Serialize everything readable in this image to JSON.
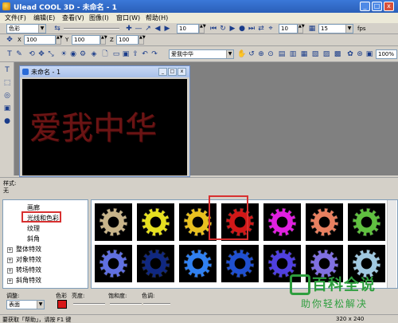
{
  "window": {
    "title": "Ulead COOL 3D - 未命名 - 1",
    "min": "_",
    "max": "□",
    "close": "x"
  },
  "menu": [
    "文件(F)",
    "编辑(E)",
    "查看(V)",
    "图像(I)",
    "窗口(W)",
    "帮助(H)"
  ],
  "toolbar1": {
    "color_mode": "色彩",
    "frame_value": "10",
    "frame_value2": "10",
    "fps_value": "15",
    "fps_label": "fps"
  },
  "toolbar2": {
    "x_label": "X",
    "x_value": "100",
    "y_label": "Y",
    "y_value": "100",
    "z_label": "Z",
    "z_value": "100"
  },
  "toolbar3": {
    "text_object": "爱我中华",
    "zoom": "100%"
  },
  "doc": {
    "title": "未命名 - 1",
    "canvas_text": "爱我中华"
  },
  "style_panel": {
    "label": "样式:",
    "value": "无"
  },
  "tree": {
    "items": [
      {
        "label": "画廊",
        "expander": ""
      },
      {
        "label": "光线和色彩",
        "expander": ""
      },
      {
        "label": "纹理",
        "expander": ""
      },
      {
        "label": "斜角",
        "expander": ""
      },
      {
        "label": "整体特效",
        "expander": "+"
      },
      {
        "label": "对象特效",
        "expander": "+"
      },
      {
        "label": "转场特效",
        "expander": "+"
      },
      {
        "label": "斜角特效",
        "expander": "+"
      }
    ]
  },
  "gallery": {
    "row1": [
      "#c8b48a",
      "#e6e020",
      "#e8c020",
      "#d01818",
      "#e020e0",
      "#e88060",
      "#60c040"
    ],
    "row2": [
      "#6070e0",
      "#102880",
      "#3080f0",
      "#2050d0",
      "#5040e0",
      "#8070e0",
      "#a0c8e0"
    ]
  },
  "bottom": {
    "adjust_label": "调整:",
    "adjust_value": "表面",
    "color_label": "色彩",
    "color_value": "#d81818",
    "brightness_label": "亮度:",
    "saturation_label": "饱和度:",
    "hue_label": "色调:"
  },
  "status": {
    "text": "要获取「帮助」，请按 F1 键",
    "size": "320 x 240"
  },
  "watermark": {
    "line1": "百科全说",
    "line2": "助你轻松解决"
  }
}
